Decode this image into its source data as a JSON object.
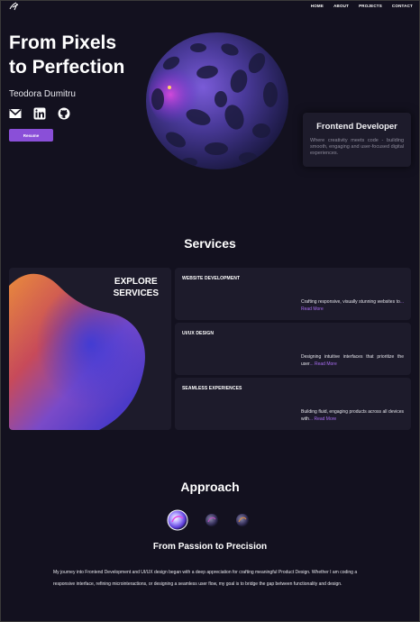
{
  "nav": {
    "logo_icon": "signature-logo-icon",
    "links": [
      "HOME",
      "ABOUT",
      "PROJECTS",
      "CONTACT"
    ]
  },
  "hero": {
    "title_line1": "From Pixels",
    "title_line2": "to Perfection",
    "name": "Teodora Dumitru",
    "socials": [
      "mail-icon",
      "linkedin-icon",
      "github-icon"
    ],
    "resume_label": "Resume"
  },
  "role_card": {
    "title": "Frontend Developer",
    "description": "Where creativity meets code - building smooth, engaging and user-focused digital experiences."
  },
  "services": {
    "title": "Services",
    "explore_line1": "EXPLORE",
    "explore_line2": "SERVICES",
    "items": [
      {
        "title": "WEBSITE DEVELOPMENT",
        "text": "Crafting responsive, visually stunning websites to",
        "more": "... Read More"
      },
      {
        "title": "UI/UX DESIGN",
        "text": "Designing intuitive interfaces that prioritize the user",
        "more": "... Read More"
      },
      {
        "title": "SEAMLESS EXPERIENCES",
        "text": "Building fluid, engaging products across all devices with",
        "more": "... Read More"
      }
    ]
  },
  "approach": {
    "title": "Approach",
    "subtitle": "From Passion to Precision",
    "body": "My journey into Frontend Development and UI/UX design began with a deep appreciation for crafting meaningful Product Design. Whether I am coding a responsive interface, refining microinteractions, or designing a seamless user flow, my goal is to bridge the gap between functionality and design."
  },
  "colors": {
    "background": "#13111f",
    "card": "#1d1b2b",
    "accent": "#8a4fd8",
    "link": "#a86df0"
  }
}
